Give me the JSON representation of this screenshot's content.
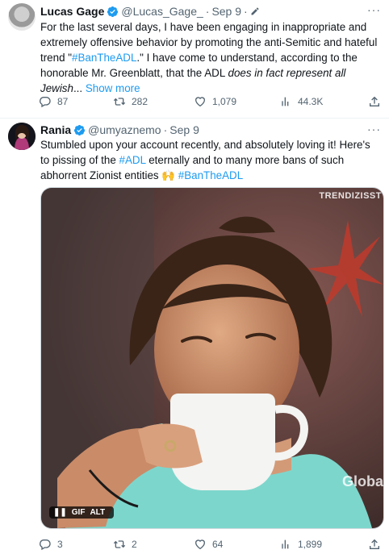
{
  "tweet1": {
    "name": "Lucas Gage",
    "handle": "@Lucas_Gage_",
    "time": "Sep 9",
    "text_a": "For the last several days, I have been engaging in inappropriate and extremely offensive behavior by promoting the anti-Semitic and hateful trend \"",
    "hashtag": "#BanTheADL",
    "text_b": ".\" I have come to understand, according to the honorable Mr. Greenblatt, that the ADL ",
    "italic": "does in fact represent all Jewish",
    "ellipsis": "... ",
    "show_more": "Show more",
    "replies": "87",
    "retweets": "282",
    "likes": "1,079",
    "views": "44.3K"
  },
  "tweet2": {
    "name": "Rania",
    "handle": "@umyaznemo",
    "time": "Sep 9",
    "text_a": "Stumbled upon your account recently, and absolutely loving it! Here's to pissing of the ",
    "hashtag1": "#ADL",
    "text_b": " eternally and to many more bans of such abhorrent Zionist entities ",
    "emoji": "🙌",
    "hashtag2": "#BanTheADL",
    "replies": "3",
    "retweets": "2",
    "likes": "64",
    "views": "1,899",
    "media": {
      "watermark": "TRENDIZISST",
      "corner_text": "Globa",
      "gif_label": "GIF",
      "alt_label": "ALT"
    }
  },
  "colors": {
    "accent": "#1d9bf0",
    "muted": "#536471"
  },
  "icons": [
    "verified-icon",
    "more-icon",
    "reply-icon",
    "retweet-icon",
    "like-icon",
    "views-icon",
    "share-icon",
    "pause-icon",
    "edit-icon"
  ]
}
